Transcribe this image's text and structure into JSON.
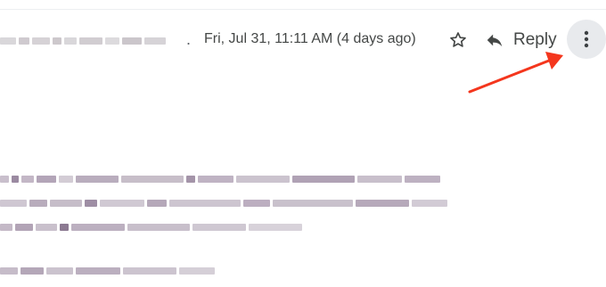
{
  "email_header": {
    "separator": ".",
    "date_label": "Fri, Jul 31, 11:11 AM (4 days ago)",
    "star_icon": "star-outline-icon",
    "reply_icon": "reply-arrow-icon",
    "reply_label": "Reply",
    "more_icon": "more-vert-icon"
  },
  "annotation": {
    "arrow_color": "#f4361d"
  },
  "colors": {
    "text": "#444746",
    "icon": "#444746",
    "more_bg": "#e8eaed",
    "blur_a": "#d9d3dc",
    "blur_b": "#b8abbd",
    "blur_c": "#7a6680"
  }
}
